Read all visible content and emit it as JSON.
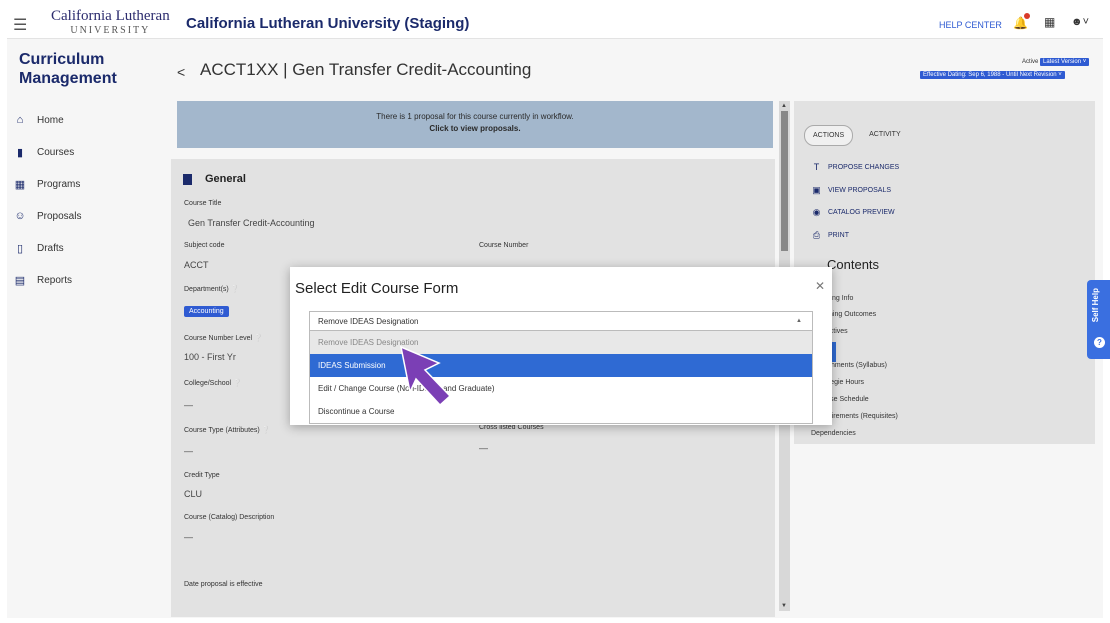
{
  "header": {
    "logo_top": "California Lutheran",
    "logo_bottom": "UNIVERSITY",
    "app_title": "California Lutheran University (Staging)",
    "help_center": "HELP CENTER"
  },
  "sidebar": {
    "title": "Curriculum Management",
    "items": [
      {
        "label": "Home",
        "icon": "home-icon"
      },
      {
        "label": "Courses",
        "icon": "book-icon"
      },
      {
        "label": "Programs",
        "icon": "grid-icon"
      },
      {
        "label": "Proposals",
        "icon": "people-icon"
      },
      {
        "label": "Drafts",
        "icon": "document-icon"
      },
      {
        "label": "Reports",
        "icon": "chart-icon"
      }
    ]
  },
  "course": {
    "title": "ACCT1XX | Gen Transfer Credit-Accounting",
    "status": "Active",
    "version": "Latest Version",
    "effective": "Effective Dating: Sep 6, 1988 - Until Next Revision"
  },
  "notice": {
    "line1": "There is 1 proposal for this course currently in workflow.",
    "line2": "Click to view proposals."
  },
  "general": {
    "heading": "General",
    "course_title_label": "Course Title",
    "course_title_value": "Gen Transfer Credit-Accounting",
    "subject_code_label": "Subject code",
    "subject_code_value": "ACCT",
    "course_number_label": "Course Number",
    "department_label": "Department(s)",
    "department_value": "Accounting",
    "level_label": "Course Number Level",
    "level_value": "100 - First Yr",
    "college_label": "College/School",
    "college_value": "—",
    "type_label": "Course Type (Attributes)",
    "type_value": "—",
    "crosslisted_label": "Cross listed Courses",
    "crosslisted_value": "—",
    "credit_type_label": "Credit Type",
    "credit_type_value": "CLU",
    "description_label": "Course (Catalog) Description",
    "description_value": "—",
    "date_label": "Date proposal is effective"
  },
  "right_panel": {
    "tab_actions": "ACTIONS",
    "tab_activity": "ACTIVITY",
    "actions": [
      "PROPOSE CHANGES",
      "VIEW PROPOSALS",
      "CATALOG PREVIEW",
      "PRINT"
    ],
    "contents_heading": "Contents",
    "contents_items": [
      "Offering Info",
      "Learning Outcomes",
      "Objectives",
      "Attachments (Syllabus)",
      "Carnegie Hours",
      "Course Schedule",
      "Requirements (Requisites)",
      "Dependencies"
    ]
  },
  "modal": {
    "title": "Select Edit Course Form",
    "selected": "Remove IDEAS Designation",
    "options": [
      "Remove IDEAS Designation",
      "IDEAS Submission",
      "Edit / Change Course (Non-IDEAS and Graduate)",
      "Discontinue a Course"
    ]
  },
  "self_help": "Self Help"
}
